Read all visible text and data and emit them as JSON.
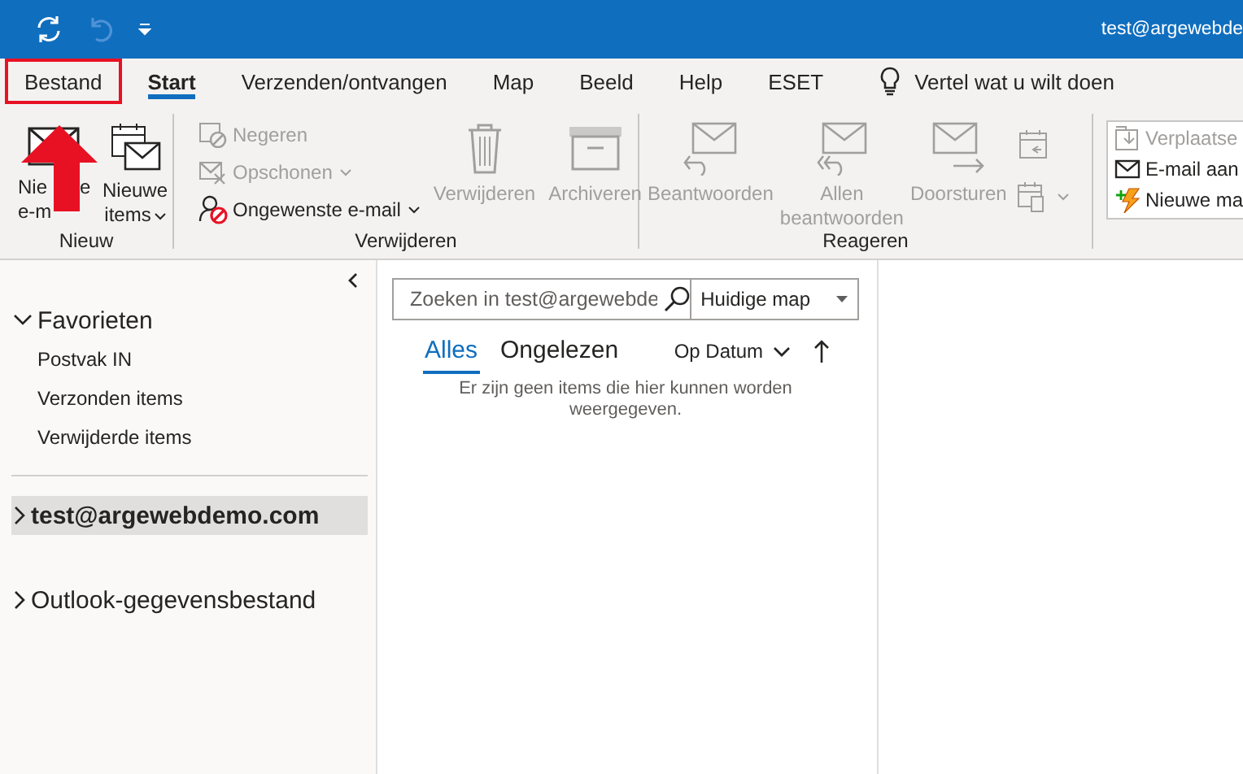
{
  "title_bar": {
    "account": "test@argewebde"
  },
  "tabs": [
    {
      "label": "Bestand",
      "selected": false,
      "highlighted": true
    },
    {
      "label": "Start",
      "selected": true,
      "highlighted": false
    },
    {
      "label": "Verzenden/ontvangen",
      "selected": false,
      "highlighted": false
    },
    {
      "label": "Map",
      "selected": false,
      "highlighted": false
    },
    {
      "label": "Beeld",
      "selected": false,
      "highlighted": false
    },
    {
      "label": "Help",
      "selected": false,
      "highlighted": false
    },
    {
      "label": "ESET",
      "selected": false,
      "highlighted": false
    }
  ],
  "tell_me": {
    "label": "Vertel wat u wilt doen"
  },
  "pointer_arrow": true,
  "ribbon": {
    "groups": [
      {
        "label": "Nieuw",
        "buttons": [
          {
            "kind": "covered",
            "label_lines": [
              [
                "Nie",
                "e"
              ],
              [
                "e-m"
              ]
            ],
            "disabled": false
          },
          {
            "kind": "large",
            "label": "Nieuwe\nitems",
            "disabled": false,
            "dropdown": true
          }
        ]
      },
      {
        "label": "Verwijderen",
        "buttons": [
          {
            "kind": "small",
            "label": "Negeren",
            "disabled": true
          },
          {
            "kind": "small",
            "label": "Opschonen",
            "disabled": true,
            "dropdown": true
          },
          {
            "kind": "small",
            "label": "Ongewenste e-mail",
            "disabled": false,
            "dropdown": true
          },
          {
            "kind": "large",
            "label": "Verwijderen",
            "disabled": true
          },
          {
            "kind": "large",
            "label": "Archiveren",
            "disabled": true
          }
        ]
      },
      {
        "label": "Reageren",
        "buttons": [
          {
            "kind": "large",
            "label": "Beantwoorden",
            "disabled": true
          },
          {
            "kind": "large",
            "label": "Allen\nbeantwoorden",
            "disabled": true
          },
          {
            "kind": "large",
            "label": "Doorsturen",
            "disabled": true
          },
          {
            "kind": "iconstack",
            "disabled": true
          },
          {
            "kind": "iconstack",
            "disabled": true,
            "dropdown": true
          }
        ]
      },
      {
        "kind": "gallery",
        "buttons": [
          {
            "kind": "small",
            "label": "Verplaatse",
            "disabled": true
          },
          {
            "kind": "small",
            "label": "E-mail aan",
            "disabled": false
          },
          {
            "kind": "small",
            "label": "Nieuwe ma",
            "disabled": false
          }
        ]
      }
    ]
  },
  "folders": [
    {
      "label": "Favorieten",
      "kind": "header",
      "expanded": true,
      "selected": false,
      "children": [
        {
          "label": "Postvak IN",
          "selected": false
        },
        {
          "label": "Verzonden items",
          "selected": false
        },
        {
          "label": "Verwijderde items",
          "selected": false
        }
      ]
    },
    {
      "label": "test@argewebdemo.com",
      "kind": "account",
      "expanded": false,
      "selected": true
    },
    {
      "label": "Outlook-gegevensbestand",
      "kind": "account",
      "expanded": false,
      "selected": false
    }
  ],
  "message_list": {
    "search": {
      "placeholder": "Zoeken in test@argewebde"
    },
    "scope": "Huidige map",
    "filters": [
      {
        "label": "Alles",
        "selected": true
      },
      {
        "label": "Ongelezen",
        "selected": false
      }
    ],
    "sort": "Op Datum",
    "empty_message": "Er zijn geen items die hier kunnen worden weergegeven."
  }
}
